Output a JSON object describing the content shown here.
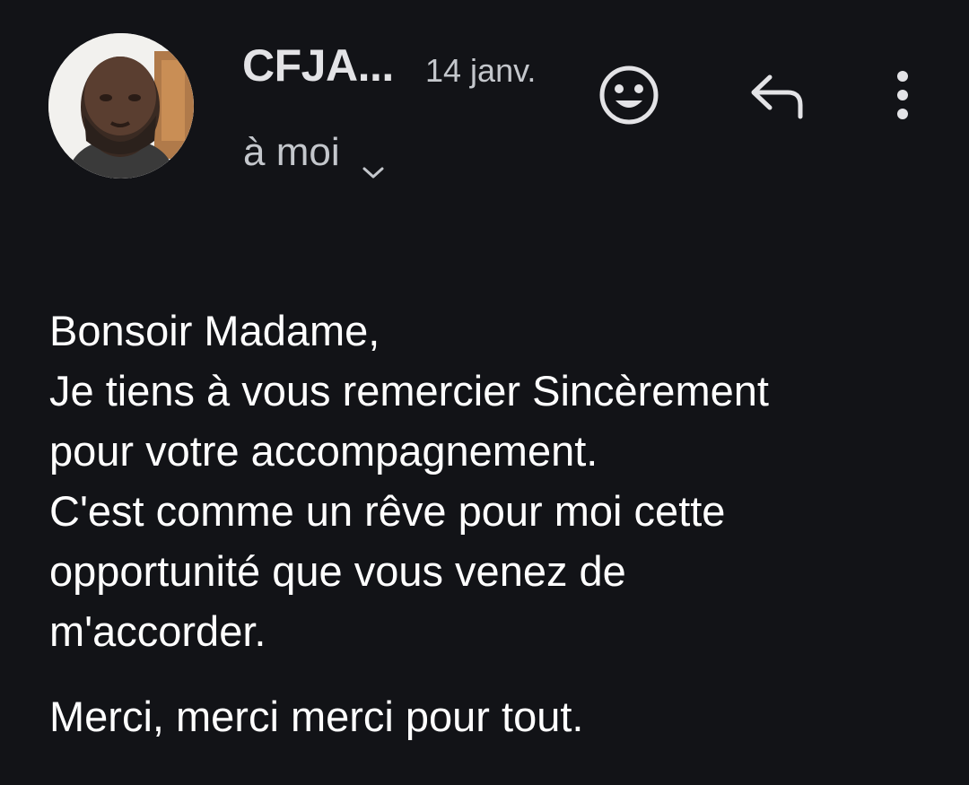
{
  "email": {
    "sender": "CFJA...",
    "date": "14 janv.",
    "recipient": "à moi",
    "body_lines": [
      "Bonsoir Madame,",
      "Je tiens à vous remercier Sincèrement",
      "pour votre accompagnement.",
      "C'est comme un rêve pour moi cette",
      "opportunité que vous venez de",
      "m'accorder."
    ],
    "closing": "Merci, merci merci pour tout."
  },
  "icons": {
    "avatar": "sender-avatar",
    "emoji": "emoji-reaction-icon",
    "reply": "reply-icon",
    "more": "more-vertical-icon",
    "expand": "chevron-down-icon"
  },
  "colors": {
    "background": "#121317",
    "text_primary": "#ffffff",
    "text_secondary": "#c4c7cc",
    "icon": "#e3e3e6"
  }
}
